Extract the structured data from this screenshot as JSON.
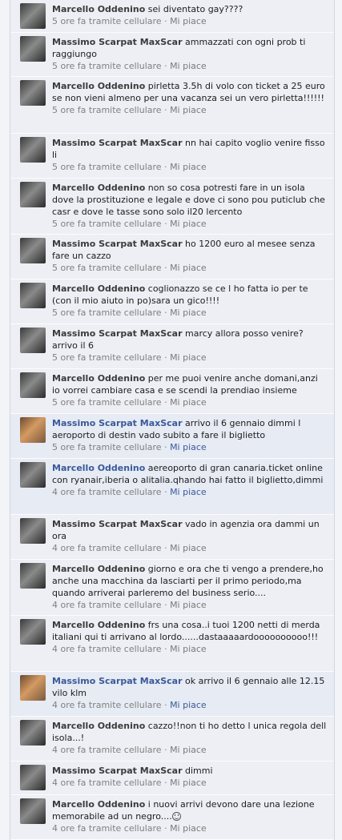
{
  "comments": [
    {
      "author": "Marcello Oddenino",
      "text": "sei diventato gay????",
      "time": "5 ore fa tramite cellulare",
      "sep": "·",
      "like": "Mi piace"
    },
    {
      "author": "Massimo Scarpat MaxScar",
      "text": "ammazzati con ogni prob ti raggiungo",
      "time": "5 ore fa tramite cellulare",
      "sep": "·",
      "like": "Mi piace"
    },
    {
      "author": "Marcello Oddenino",
      "text": "pirletta 3.5h di volo con ticket a 25 euro se non vieni almeno per una vacanza sei un vero pirletta!!!!!!",
      "time": "5 ore fa tramite cellulare",
      "sep": "·",
      "like": "Mi piace"
    },
    {
      "author": "Massimo Scarpat MaxScar",
      "text": "nn hai capito voglio venire fisso li",
      "time": "5 ore fa tramite cellulare",
      "sep": "·",
      "like": "Mi piace"
    },
    {
      "author": "Marcello Oddenino",
      "text": "non so cosa potresti fare in un isola dove la prostituzione e legale e dove ci sono pou puticlub che casr e dove le tasse sono solo il20 lercento",
      "time": "5 ore fa tramite cellulare",
      "sep": "·",
      "like": "Mi piace"
    },
    {
      "author": "Massimo Scarpat MaxScar",
      "text": "ho 1200 euro al mesee senza fare un cazzo",
      "time": "5 ore fa tramite cellulare",
      "sep": "·",
      "like": "Mi piace"
    },
    {
      "author": "Marcello Oddenino",
      "text": "coglionazzo se ce l ho fatta io per te (con il mio aiuto in po)sara un gico!!!!",
      "time": "5 ore fa tramite cellulare",
      "sep": "·",
      "like": "Mi piace"
    },
    {
      "author": "Massimo Scarpat MaxScar",
      "text": "marcy allora posso venire? arrivo il 6",
      "time": "5 ore fa tramite cellulare",
      "sep": "·",
      "like": "Mi piace"
    },
    {
      "author": "Marcello Oddenino",
      "text": "per me puoi venire anche domani,anzi io vorrei cambiare casa e se scendi la prendiao insieme",
      "time": "5 ore fa tramite cellulare",
      "sep": "·",
      "like": "Mi piace"
    },
    {
      "author": "Massimo Scarpat MaxScar",
      "text": "arrivo il 6 gennaio dimmi l aeroporto di destin vado subito a fare il biglietto",
      "time": "5 ore fa tramite cellulare",
      "sep": "·",
      "like": "Mi piace"
    },
    {
      "author": "Marcello Oddenino",
      "text": "aereoporto di gran canaria.ticket online con ryanair,iberia o alitalia.qhando hai fatto il biglietto,dimmi",
      "time": "4 ore fa tramite cellulare",
      "sep": "·",
      "like": "Mi piace"
    },
    {
      "author": "Massimo Scarpat MaxScar",
      "text": "vado in agenzia ora dammi un ora",
      "time": "4 ore fa tramite cellulare",
      "sep": "·",
      "like": "Mi piace"
    },
    {
      "author": "Marcello Oddenino",
      "text": "giorno e ora che ti vengo a prendere,ho anche una macchina da lasciarti per il primo periodo,ma quando arriverai parleremo del business serio....",
      "time": "4 ore fa tramite cellulare",
      "sep": "·",
      "like": "Mi piace"
    },
    {
      "author": "Marcello Oddenino",
      "text": "frs una cosa..i tuoi 1200 netti di merda italiani qui ti arrivano al lordo......dastaaaaardoooooooooo!!!",
      "time": "4 ore fa tramite cellulare",
      "sep": "·",
      "like": "Mi piace"
    },
    {
      "author": "Massimo Scarpat MaxScar",
      "text": "ok arrivo il 6 gennaio alle 12.15 vilo klm",
      "time": "4 ore fa tramite cellulare",
      "sep": "·",
      "like": "Mi piace"
    },
    {
      "author": "Marcello Oddenino",
      "text": "cazzo!!non ti ho detto l unica regola dell isola...!",
      "time": "4 ore fa tramite cellulare",
      "sep": "·",
      "like": "Mi piace"
    },
    {
      "author": "Massimo Scarpat MaxScar",
      "text": "dimmi",
      "time": "4 ore fa tramite cellulare",
      "sep": "·",
      "like": "Mi piace"
    },
    {
      "author": "Marcello Oddenino",
      "text": "i nuovi arrivi devono dare una lezione memorabile ad un negro....",
      "time": "4 ore fa tramite cellulare",
      "sep": "·",
      "like": "Mi piace"
    }
  ]
}
